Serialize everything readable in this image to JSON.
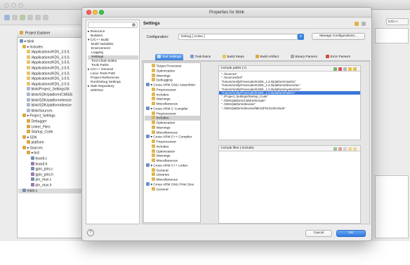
{
  "dialog": {
    "title": "Properties for blink",
    "filter_placeholder": "",
    "section_title": "Settings",
    "configuration_label": "Configuration:",
    "configuration_value": "Debug  [ Active ]",
    "manage_button": "Manage Configurations...",
    "help": "?",
    "cancel_button": "Cancel",
    "ok_button": "OK",
    "nav": [
      "▸ Resource",
      "Builders",
      "▾ C/C++ Build",
      "Build Variables",
      "Environment",
      "Logging",
      "Settings",
      "Tool Chain Editor",
      "Tools Paths",
      "▸ C/C++ General",
      "Linux Tools Path",
      "Project References",
      "Run/Debug Settings",
      "▸ Task Repository",
      "WikiText"
    ],
    "tabs": [
      "Tool Settings",
      "Toolchains",
      "Build Steps",
      "Build Artifact",
      "Binary Parsers",
      "Error Parsers"
    ],
    "tool_tree": [
      "Target Processor",
      "Optimization",
      "Warnings",
      "Debugging",
      "▾ Cross ARM GNU Assembler",
      "Preprocessor",
      "Includes",
      "Warnings",
      "Miscellaneous",
      "▾ Cross ARM C Compiler",
      "Preprocessor",
      "Includes",
      "Optimization",
      "Warnings",
      "Miscellaneous",
      "▾ Cross ARM C++ Compiler",
      "Preprocessor",
      "Includes",
      "Optimization",
      "Warnings",
      "Miscellaneous",
      "▾ Cross ARM C++ Linker",
      "General",
      "Libraries",
      "Miscellaneous",
      "▾ Cross ARM GNU Print Size",
      "General"
    ],
    "include_paths_label": "Include paths (-I)",
    "include_paths": [
      "\"../Sources\"",
      "\"../Sources/brd\"",
      "\"/Users/mrelly/Freescale/KSDK_1.2.0/platform/osa/inc\"",
      "\"/Users/mrelly/Freescale/KSDK_1.2.0/platform/drivers/inc\"",
      "\"/Users/mrelly/Freescale/KSDK_1.2.0/platform/system/inc\"",
      "\"/Users/mrelly/Freescale/KSDK_1.2.0/platform/hal/inc\"",
      "\"../Project_Settings/Startup_Code\"",
      "\"../SDK/platform/CMSIS/Include\"",
      "\"../SDK/platform/devices\"",
      "\"../SDK/platform/devices/MK22F51212/include\""
    ],
    "include_files_label": "Include files (-include)"
  },
  "project_explorer": {
    "tab_label": "Project Explorer",
    "tree": [
      "▾ blink",
      "▾ Includes",
      "/Applications/KDS_3.0.0.",
      "/Applications/KDS_3.0.0.",
      "/Applications/KDS_3.0.0.",
      "/Applications/KDS_3.0.0.",
      "/Applications/KDS_3.0.0.",
      "/Applications/KDS_3.0.0.",
      "/Applications/KDS_3.0.0.",
      "blink/Project_Settings/St",
      "blink/SDK/platform/CMSIS",
      "blink/SDK/platform/device",
      "blink/SDK/platform/device",
      "blink/Sources",
      "▾ Project_Settings",
      "Debugger",
      "Linker_Files",
      "Startup_Code",
      "▾ SDK",
      "platform",
      "▾ Sources",
      "▾ brd",
      "board.c",
      "board.h",
      "gpio_pins.c",
      "gpio_pins.h",
      "pin_mux.c",
      "pin_mux.h",
      "main.c"
    ]
  },
  "ide": {
    "right_tab": "C/C++"
  }
}
